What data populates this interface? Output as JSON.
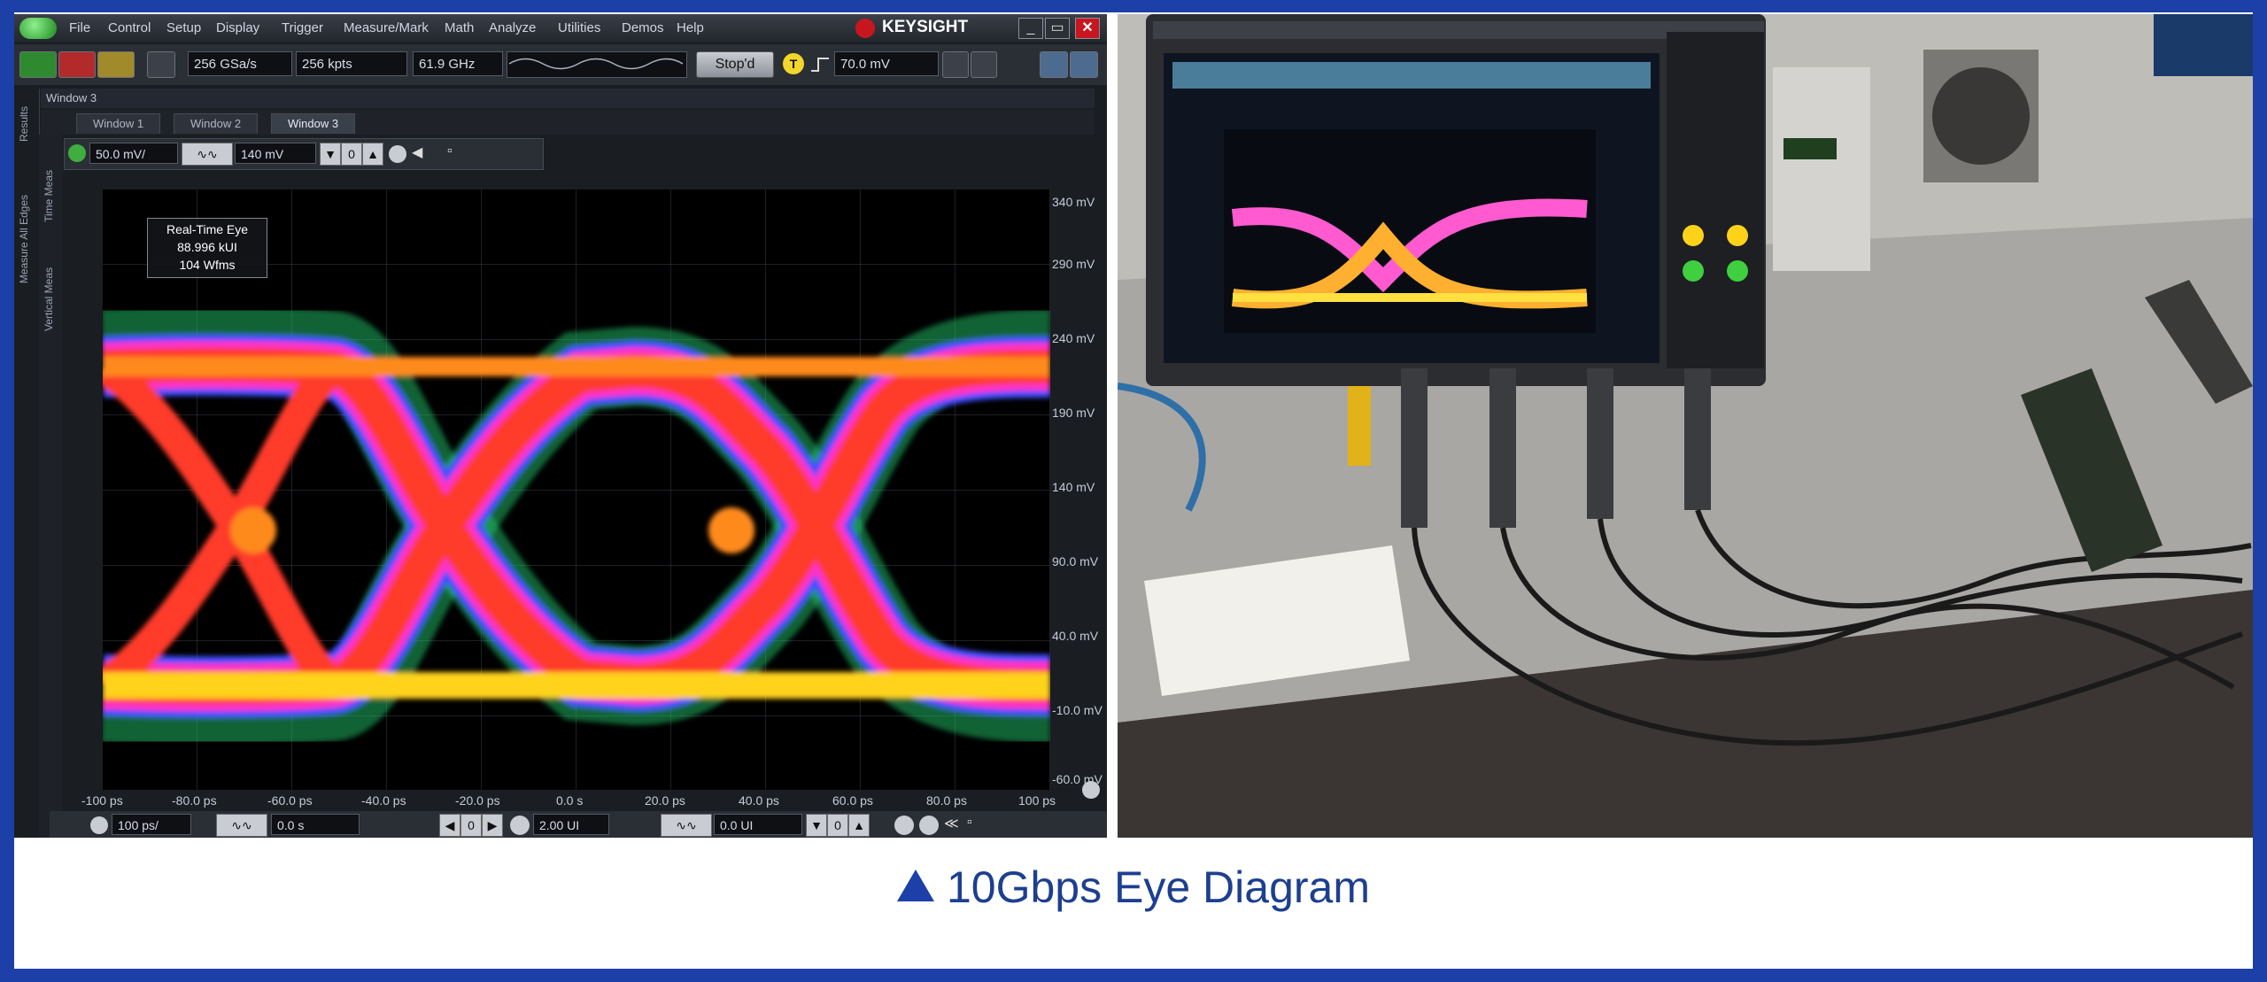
{
  "scope": {
    "menu": [
      "File",
      "Control",
      "Setup",
      "Display",
      "Trigger",
      "Measure/Mark",
      "Math",
      "Analyze",
      "Utilities",
      "Demos",
      "Help"
    ],
    "brand": "KEYSIGHT",
    "toolbar": {
      "sample_rate": "256 GSa/s",
      "memory_depth": "256 kpts",
      "bandwidth": "61.9 GHz",
      "stop_label": "Stop'd",
      "trigger_icon": "T",
      "trigger_level": "70.0 mV"
    },
    "window_title": "Window 3",
    "tabs": [
      "Window 1",
      "Window 2",
      "Window 3"
    ],
    "side_tabs": [
      "Results",
      "Measure All Edges"
    ],
    "vertical_tabs": [
      "Time Meas",
      "Vertical Meas"
    ],
    "scale": {
      "vertical": "50.0 mV/",
      "offset": "140 mV"
    },
    "measurement": {
      "title": "Real-Time Eye",
      "ui_count": "88.996 kUI",
      "waveforms": "104 Wfms"
    },
    "y_axis_labels": [
      "340 mV",
      "290 mV",
      "240 mV",
      "190 mV",
      "140 mV",
      "90.0 mV",
      "40.0 mV",
      "-10.0 mV",
      "-60.0 mV"
    ],
    "x_axis_labels": [
      "-100 ps",
      "-80.0 ps",
      "-60.0 ps",
      "-40.0 ps",
      "-20.0 ps",
      "0.0 s",
      "20.0 ps",
      "40.0 ps",
      "60.0 ps",
      "80.0 ps",
      "100 ps"
    ],
    "bottom": {
      "timebase": "100 ps/",
      "position": "0.0 s",
      "ui_scale": "2.00 UI",
      "ui_offset": "0.0 UI"
    }
  },
  "caption": "10Gbps Eye Diagram",
  "colors": {
    "accent": "#1c3fa8",
    "caption_text": "#1d3f8f",
    "eye_hot": "#ffd21a",
    "eye_mid": "#ff3a2b",
    "eye_edge": "#ff32c8",
    "eye_outer": "#4050ff",
    "eye_noise": "#22c36a"
  }
}
